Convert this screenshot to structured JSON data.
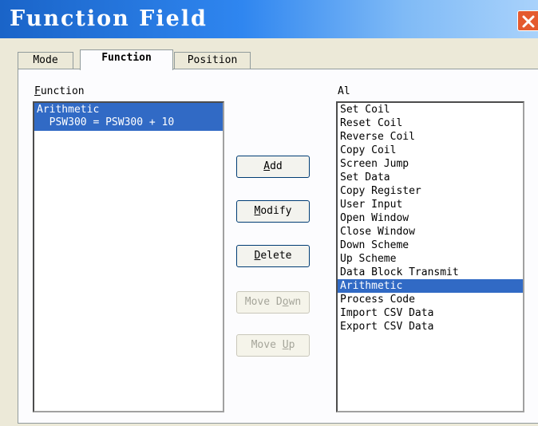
{
  "window": {
    "title": "Function Field"
  },
  "tabs": [
    {
      "label": "Mode"
    },
    {
      "label": "Function",
      "selected": true
    },
    {
      "label": "Position"
    }
  ],
  "function_panel": {
    "label_first": "F",
    "label_rest": "unction",
    "items": [
      {
        "lines": [
          "Arithmetic",
          "  PSW300 = PSW300 + 10"
        ],
        "selected": true
      }
    ]
  },
  "all_panel": {
    "label": "Al",
    "items": [
      "Set Coil",
      "Reset Coil",
      "Reverse Coil",
      "Copy Coil",
      "Screen Jump",
      "Set Data",
      "Copy Register",
      "User Input",
      "Open Window",
      "Close Window",
      "Down Scheme",
      "Up Scheme",
      "Data Block Transmit",
      "Arithmetic",
      "Process Code",
      "Import CSV Data",
      "Export CSV Data"
    ],
    "selected_index": 13
  },
  "buttons": {
    "add": {
      "pre": "",
      "u": "A",
      "post": "dd",
      "enabled": true
    },
    "modify": {
      "pre": "",
      "u": "M",
      "post": "odify",
      "enabled": true
    },
    "delete": {
      "pre": "",
      "u": "D",
      "post": "elete",
      "enabled": true
    },
    "move_down": {
      "pre": "Move D",
      "u": "o",
      "post": "wn",
      "enabled": false
    },
    "move_up": {
      "pre": "Move ",
      "u": "U",
      "post": "p",
      "enabled": false
    }
  },
  "colors": {
    "selection": "#316ac5",
    "title_bar": "#2f86f0",
    "close_button": "#e45a2e"
  },
  "icons": {
    "close": "close-icon"
  }
}
